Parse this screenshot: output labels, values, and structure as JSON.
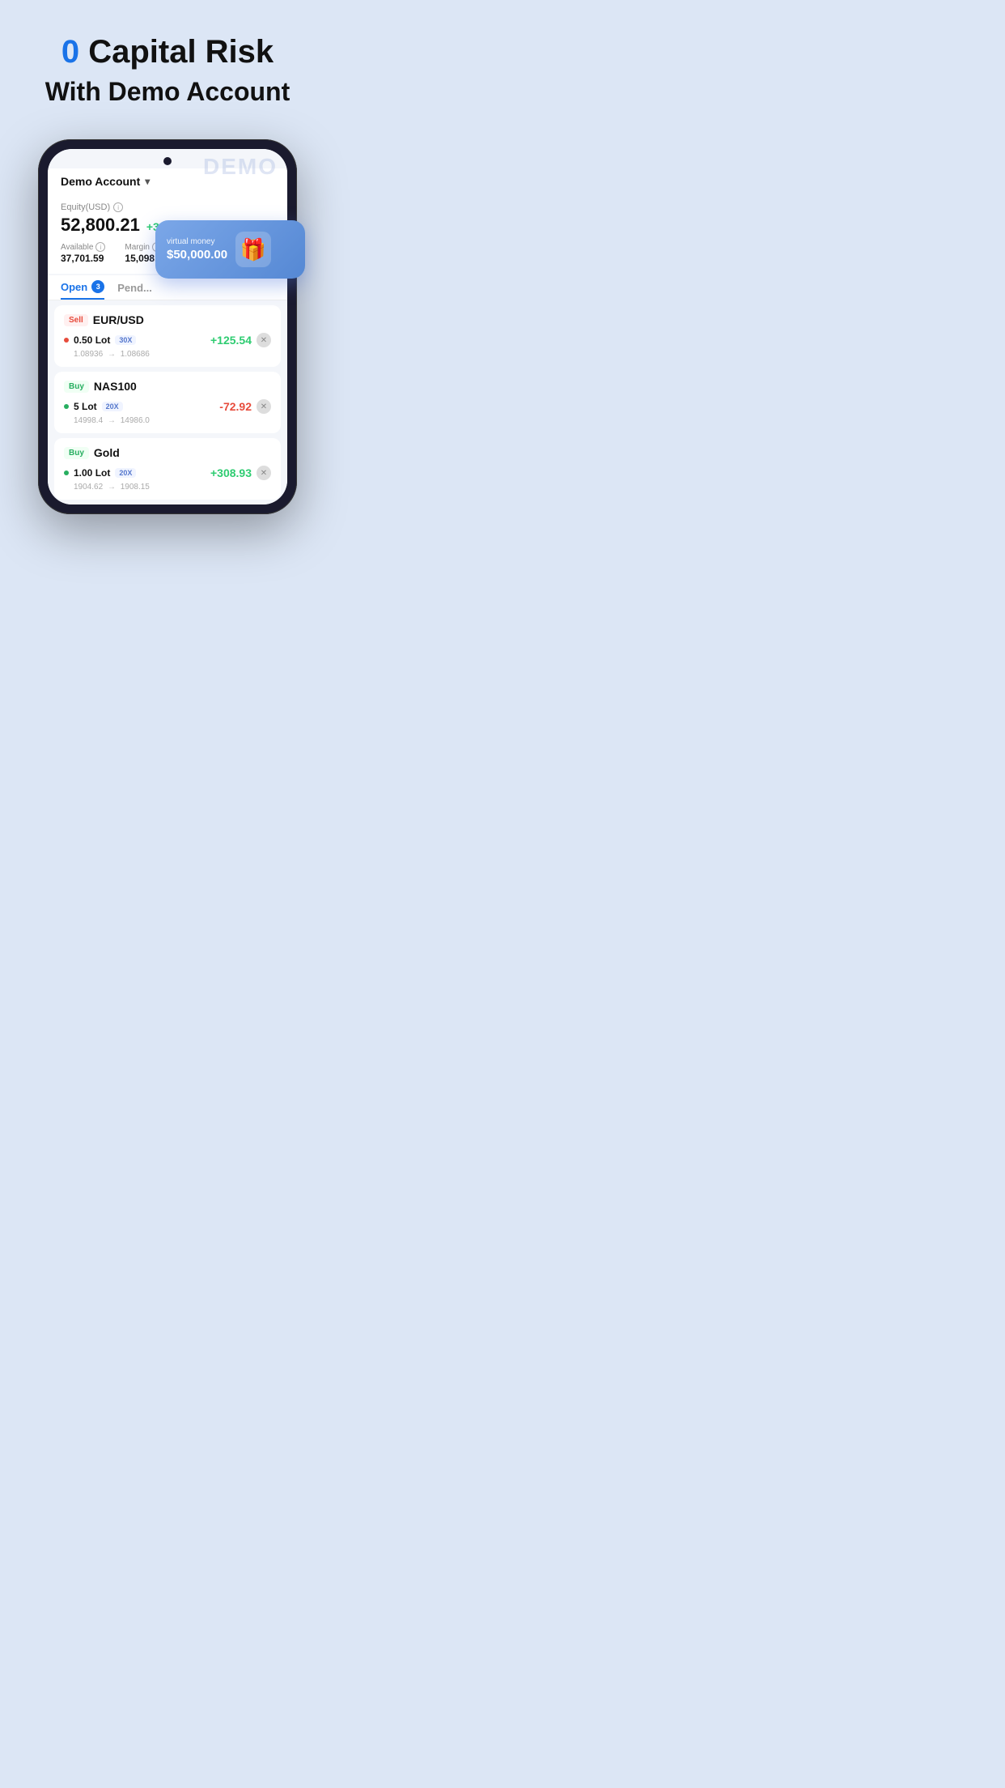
{
  "hero": {
    "zero": "0",
    "title_rest": " Capital Risk",
    "subtitle": "With Demo Account"
  },
  "app": {
    "account_name": "Demo Account",
    "demo_watermark": "DEMO"
  },
  "equity": {
    "label": "Equity(USD)",
    "value": "52,800.21",
    "change": "+360.55",
    "available_label": "Available",
    "available_value": "37,701.59",
    "margin_label": "Margin",
    "margin_value": "15,098.63"
  },
  "virtual_card": {
    "label": "virtual money",
    "amount": "$50,000.00"
  },
  "tabs": {
    "open_label": "Open",
    "open_count": "3",
    "pending_label": "Pend..."
  },
  "trades": [
    {
      "id": "trade-1",
      "type": "Sell",
      "symbol": "EUR/USD",
      "lot": "0.50 Lot",
      "leverage": "30X",
      "pnl": "+125.54",
      "pnl_positive": true,
      "from_price": "1.08936",
      "to_price": "1.08686"
    },
    {
      "id": "trade-2",
      "type": "Buy",
      "symbol": "NAS100",
      "lot": "5 Lot",
      "leverage": "20X",
      "pnl": "-72.92",
      "pnl_positive": false,
      "from_price": "14998.4",
      "to_price": "14986.0"
    },
    {
      "id": "trade-3",
      "type": "Buy",
      "symbol": "Gold",
      "lot": "1.00 Lot",
      "leverage": "20X",
      "pnl": "+308.93",
      "pnl_positive": true,
      "from_price": "1904.62",
      "to_price": "1908.15"
    }
  ]
}
